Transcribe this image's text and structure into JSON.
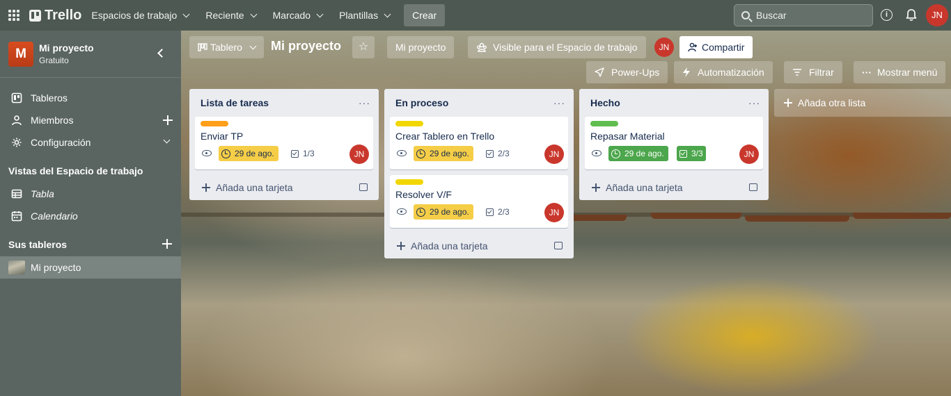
{
  "topbar": {
    "brand": "Trello",
    "nav": [
      {
        "label": "Espacios de trabajo"
      },
      {
        "label": "Reciente"
      },
      {
        "label": "Marcado"
      },
      {
        "label": "Plantillas"
      }
    ],
    "create_label": "Crear",
    "search_placeholder": "Buscar",
    "user_initials": "JN"
  },
  "sidebar": {
    "workspace_initial": "M",
    "workspace_name": "Mi proyecto",
    "workspace_plan": "Gratuito",
    "items": [
      {
        "label": "Tableros"
      },
      {
        "label": "Miembros"
      },
      {
        "label": "Configuración"
      }
    ],
    "views_heading": "Vistas del Espacio de trabajo",
    "views": [
      {
        "label": "Tabla"
      },
      {
        "label": "Calendario"
      }
    ],
    "boards_heading": "Sus tableros",
    "boards": [
      {
        "label": "Mi proyecto"
      }
    ]
  },
  "board": {
    "view_label": "Tablero",
    "title": "Mi proyecto",
    "workspace_label": "Mi proyecto",
    "visibility_label": "Visible para el Espacio de trabajo",
    "member_initials": "JN",
    "share_label": "Compartir",
    "powerups_label": "Power-Ups",
    "automation_label": "Automatización",
    "filter_label": "Filtrar",
    "menu_label": "Mostrar menú",
    "menu_glyph": "···",
    "add_card_label": "Añada una tarjeta",
    "add_list_label": "Añada otra lista",
    "lists": [
      {
        "title": "Lista de tareas",
        "cards": [
          {
            "title": "Enviar TP",
            "label_color": "#ff9f1a",
            "due": "29 de ago.",
            "due_color": "#f5cd47",
            "due_text_color": "#172b4d",
            "checklist": "1/3",
            "checklist_done": false,
            "member": "JN"
          }
        ]
      },
      {
        "title": "En proceso",
        "cards": [
          {
            "title": "Crear Tablero en Trello",
            "label_color": "#f2d600",
            "due": "29 de ago.",
            "due_color": "#f5cd47",
            "due_text_color": "#172b4d",
            "checklist": "2/3",
            "checklist_done": false,
            "member": "JN"
          },
          {
            "title": "Resolver V/F",
            "label_color": "#f2d600",
            "due": "29 de ago.",
            "due_color": "#f5cd47",
            "due_text_color": "#172b4d",
            "checklist": "2/3",
            "checklist_done": false,
            "member": "JN"
          }
        ]
      },
      {
        "title": "Hecho",
        "cards": [
          {
            "title": "Repasar Material",
            "label_color": "#61bd4f",
            "due": "29 de ago.",
            "due_color": "#4bce97",
            "due_text_color": "#ffffff",
            "checklist": "3/3",
            "checklist_done": true,
            "member": "JN"
          }
        ]
      }
    ]
  },
  "colors": {
    "topbar_bg": "#4e5852",
    "sidebar_bg": "#5a6561",
    "avatar": "#c9372c",
    "workspace_logo": "#d84c1f",
    "done_green": "#4bce97",
    "due_yellow": "#f5cd47"
  }
}
